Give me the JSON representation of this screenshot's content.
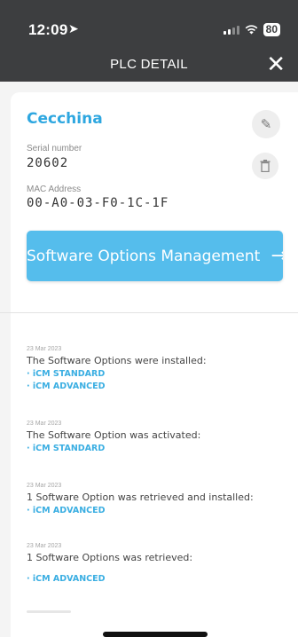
{
  "status_bar": {
    "time": "12:09",
    "location_glyph": "➤",
    "battery": "80"
  },
  "header": {
    "title": "PLC DETAIL",
    "close_glyph": "✕"
  },
  "plc": {
    "name": "Cecchina",
    "serial_label": "Serial number",
    "serial_value": "20602",
    "mac_label": "MAC Address",
    "mac_value": "00-A0-03-F0-1C-1F"
  },
  "actions": {
    "edit_glyph": "✎",
    "delete_glyph": "🗑"
  },
  "software_button": {
    "label": "Software Options Management",
    "arrow": "→"
  },
  "logs": [
    {
      "date": "23 Mar 2023",
      "message": "The Software Options were installed:",
      "options": [
        "· iCM STANDARD",
        "· iCM ADVANCED"
      ]
    },
    {
      "date": "23 Mar 2023",
      "message": "The Software Option was activated:",
      "options": [
        "· iCM STANDARD"
      ]
    },
    {
      "date": "23 Mar 2023",
      "message": "1 Software Option was retrieved and installed:",
      "options": [
        "· iCM ADVANCED"
      ]
    },
    {
      "date": "23 Mar 2023",
      "message": "1 Software Options was retrieved:",
      "options": [
        "· iCM ADVANCED"
      ]
    }
  ],
  "colors": {
    "header_bg": "#3d3e40",
    "accent": "#2ea7e0",
    "button_bg": "#55bdec"
  }
}
